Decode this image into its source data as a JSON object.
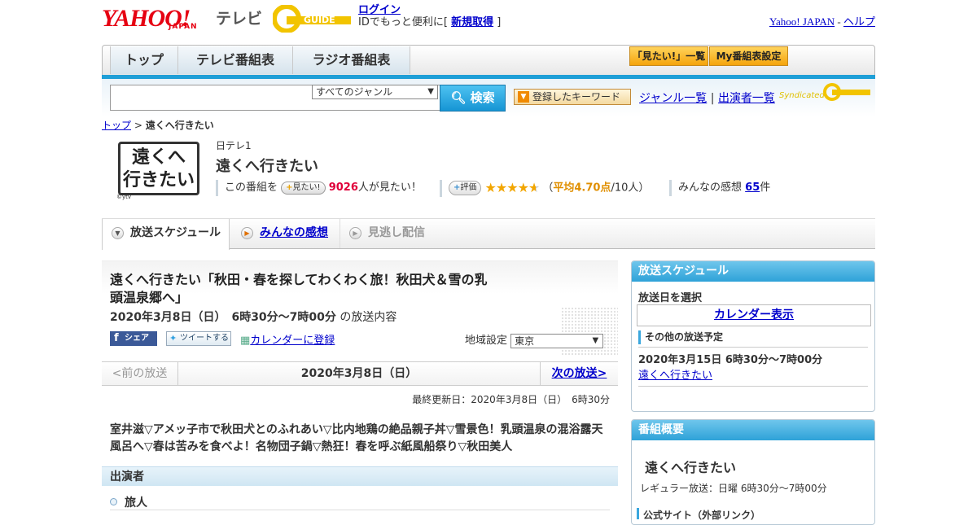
{
  "header": {
    "yahoo_logo": "YAHOO!",
    "japan_logo": "JAPAN",
    "tv_label": "テレビ",
    "gguide_logo": "G-GUIDE",
    "login": "ログイン",
    "id_text": "IDでもっと便利に[",
    "signup": "新規取得",
    "id_text_end": "]",
    "yahoo_japan_link": "Yahoo! JAPAN",
    "separator": "-",
    "help_link": "ヘルプ"
  },
  "nav": {
    "tabs": [
      {
        "label": "トップ"
      },
      {
        "label": "テレビ番組表"
      },
      {
        "label": "ラジオ番組表"
      }
    ],
    "mitai_list": "「見たい!」一覧",
    "my_schedule": "My番組表設定"
  },
  "search": {
    "genre": "すべてのジャンル",
    "button": "検索",
    "keyword_button": "登録したキーワード",
    "genre_list": "ジャンル一覧",
    "divider": "|",
    "performer_list": "出演者一覧",
    "syndicated": "Syndicated"
  },
  "breadcrumb": {
    "top": "トップ",
    "sep": ">",
    "current": "遠くへ行きたい"
  },
  "program": {
    "logo_line1": "遠くへ",
    "logo_line2": "行きたい",
    "logo_credit": "©ytv",
    "channel": "日テレ1",
    "title": "遠くへ行きたい",
    "mitai_prefix": "この番組を",
    "mitai_button": "見たい!",
    "mitai_count": "9026",
    "mitai_suffix": "人が見たい！",
    "rating_button": "評価",
    "rating_stars": 4.7,
    "rating_open": "（",
    "rating_avg": "平均4.70点",
    "rating_count": "/10人）",
    "impressions_label": "みんなの感想",
    "impressions_count": "65",
    "impressions_unit": "件"
  },
  "subtabs": [
    {
      "label": "放送スケジュール"
    },
    {
      "label": "みんなの感想"
    },
    {
      "label": "見逃し配信"
    }
  ],
  "episode": {
    "title": "遠くへ行きたい「秋田・春を探してわくわく旅！秋田犬＆雪の乳頭温泉郷へ」",
    "date": "2020年3月8日（日）　6時30分～7時00分",
    "date_suffix": "の放送内容",
    "share": "シェア",
    "tweet": "ツイートする",
    "calendar_register": "カレンダーに登録",
    "region_label": "地域設定",
    "region_value": "東京",
    "prev": "<前の放送",
    "current_date": "2020年3月8日（日）",
    "next": "次の放送>",
    "updated": "最終更新日：2020年3月8日（日）　6時30分",
    "description": "室井滋▽アメッ子市で秋田犬とのふれあい▽比内地鶏の絶品親子丼▽雪景色！乳頭温泉の混浴露天風呂へ▽春は苦みを食べよ！名物団子鍋▽熱狂！春を呼ぶ紙風船祭り▽秋田美人",
    "cast_header": "出演者",
    "cast_role": "旅人"
  },
  "sidebar": {
    "schedule_header": "放送スケジュール",
    "select_date": "放送日を選択",
    "calendar_button": "カレンダー表示",
    "other_header": "その他の放送予定",
    "other_date": "2020年3月15日  6時30分～7時00分",
    "other_link": "遠くへ行きたい",
    "summary_header": "番組概要",
    "summary_title": "遠くへ行きたい",
    "summary_regular": "レギュラー放送：日曜 6時30分～7時00分",
    "summary_official": "公式サイト（外部リンク）"
  },
  "colors": {
    "accent_blue": "#1f9fd7",
    "yahoo_red": "#e60012",
    "star_orange": "#f2a600"
  }
}
